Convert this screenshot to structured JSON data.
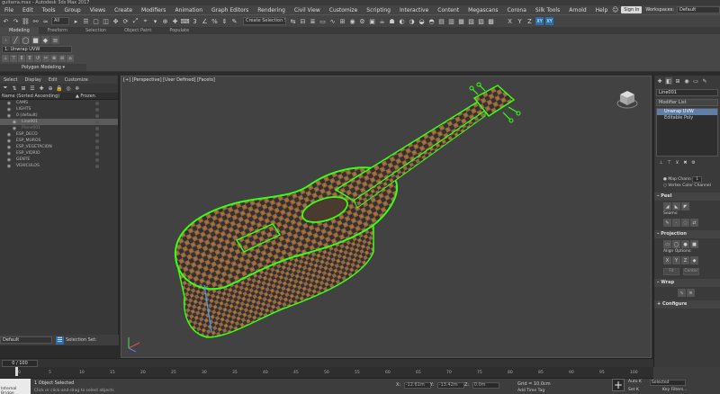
{
  "window": {
    "title": "guitarra.max - Autodesk 3ds Max 2017"
  },
  "menu": [
    "File",
    "Edit",
    "Tools",
    "Group",
    "Views",
    "Create",
    "Modifiers",
    "Animation",
    "Graph Editors",
    "Rendering",
    "Civil View",
    "Customize",
    "Scripting",
    "Interactive",
    "Content",
    "Megascans",
    "Corona",
    "Silk Tools",
    "Arnold",
    "Help"
  ],
  "account": {
    "sign_in": "Sign In",
    "workspaces_label": "Workspaces:",
    "workspace_value": "Default"
  },
  "main_toolbar": {
    "filter": "All",
    "selection_set_placeholder": "Create Selection Se",
    "right_buttons": [
      "X",
      "Y",
      "Z",
      "XY",
      "XY"
    ]
  },
  "ribbon": {
    "tabs": [
      "Modeling",
      "Freeform",
      "Selection",
      "Object Paint",
      "Populate"
    ],
    "modifier_field": "1: Unwrap UVW",
    "panel_label": "Polygon Modeling ▾"
  },
  "scene_explorer": {
    "menu": [
      "Select",
      "Display",
      "Edit",
      "Customize"
    ],
    "col_name": "Name (Sorted Ascending)",
    "col_frozen": "▲ Frozen",
    "rows": [
      {
        "name": "CAMS",
        "indent": 0,
        "selected": false,
        "dim": false
      },
      {
        "name": "LIGHTS",
        "indent": 0,
        "selected": false,
        "dim": false
      },
      {
        "name": "0 (default)",
        "indent": 0,
        "selected": false,
        "dim": false
      },
      {
        "name": "Line001",
        "indent": 1,
        "selected": true,
        "dim": false
      },
      {
        "name": "Plane001",
        "indent": 1,
        "selected": false,
        "dim": true
      },
      {
        "name": "ESP_DECO",
        "indent": 0,
        "selected": false,
        "dim": false
      },
      {
        "name": "ESP_MUROS",
        "indent": 0,
        "selected": false,
        "dim": false
      },
      {
        "name": "ESP_VEGETACION",
        "indent": 0,
        "selected": false,
        "dim": false
      },
      {
        "name": "ESP_VIDRIO",
        "indent": 0,
        "selected": false,
        "dim": false
      },
      {
        "name": "GENTE",
        "indent": 0,
        "selected": false,
        "dim": false
      },
      {
        "name": "VEHICULOS",
        "indent": 0,
        "selected": false,
        "dim": false
      }
    ],
    "bottom_dropdown": "Default",
    "selection_set": "Selection Set:"
  },
  "viewport": {
    "label": "[+] [Perspective] [User Defined] [Facets]",
    "colors": {
      "wire": "#39ff14",
      "checker_dark": "#3a2f2a",
      "checker_light": "#8a6a4a",
      "checker_orange": "#c8701e"
    }
  },
  "command_panel": {
    "object_name": "Line001",
    "modifier_list": "Modifier List",
    "stack": [
      "Unwrap UVW",
      "Editable Poly"
    ],
    "map_channel_label": "Map Chann",
    "map_channel_value": "1",
    "vertex_color_channel": "Vertex Color Channel",
    "peel": "Peel",
    "seams": "Seams:",
    "projection": "Projection",
    "align_options": "Align Options:",
    "fit": "Fit",
    "center": "Center",
    "wrap": "Wrap",
    "configure": "Configure"
  },
  "timeline": {
    "frame": "0 / 100",
    "ticks": [
      "0",
      "5",
      "10",
      "15",
      "20",
      "25",
      "30",
      "35",
      "40",
      "45",
      "50",
      "55",
      "60",
      "65",
      "70",
      "75",
      "80",
      "85",
      "90",
      "95",
      "100"
    ]
  },
  "status": {
    "maxscript": "Internal Bridge",
    "line1": "1 Object Selected",
    "line2": "Click or click-and-drag to select objects",
    "x": "-12.61m",
    "y": "-13.42m",
    "z": "0.0m",
    "grid": "Grid = 10.0cm",
    "add_time_tag": "Add Time Tag",
    "auto_key": "Auto K",
    "selected_dd": "Selected",
    "set_key": "Set K",
    "key_filters": "Key Filters..."
  }
}
